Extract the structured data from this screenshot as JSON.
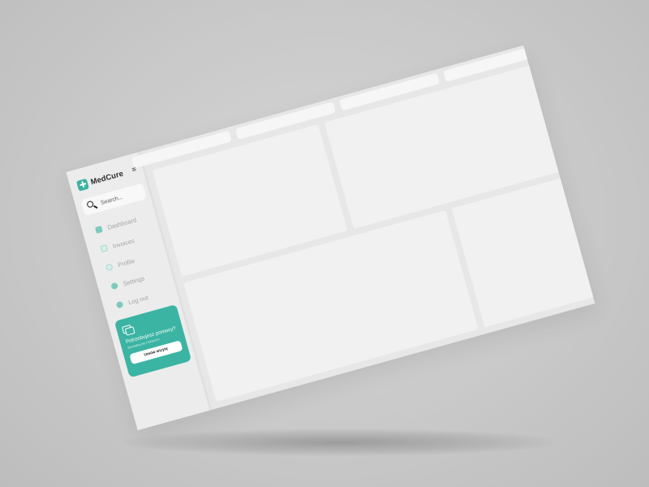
{
  "app": {
    "brand_name": "MedCure"
  },
  "sidebar": {
    "menu_icon": "hamburger-icon",
    "search": {
      "placeholder": "Search...",
      "icon": "search-icon"
    },
    "nav": [
      {
        "label": "Dashboard",
        "icon": "dashboard-icon"
      },
      {
        "label": "Invoices",
        "icon": "invoice-icon"
      },
      {
        "label": "Profile",
        "icon": "profile-icon"
      },
      {
        "label": "Settings",
        "icon": "settings-icon"
      },
      {
        "label": "Log out",
        "icon": "logout-icon"
      }
    ],
    "help_card": {
      "icon": "chat-icon",
      "title": "Potrzebujesz pomocy?",
      "subtitle": "Skontaktuj się z lekarzem",
      "button_label": "Umów wizytę"
    }
  },
  "colors": {
    "accent": "#3bb3a2",
    "background": "#c9c9c9",
    "screen": "#e7e7e7",
    "panel": "#f1f1f1"
  }
}
